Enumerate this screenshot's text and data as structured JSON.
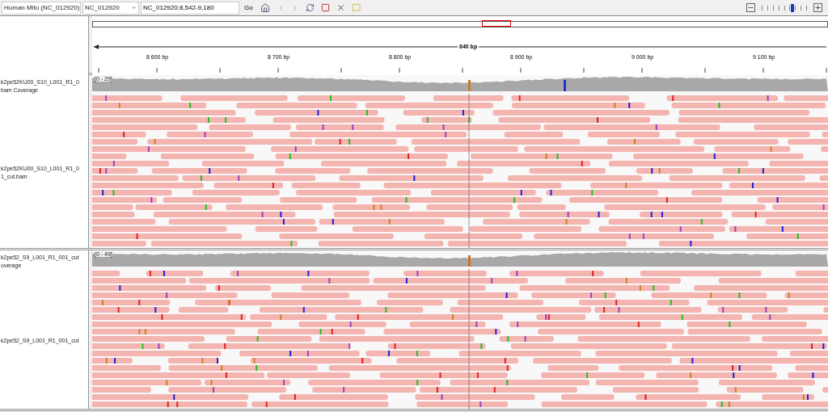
{
  "toolbar": {
    "genome": "Human Mito (NC_012920)",
    "chromosome": "NC_012920",
    "locus": "NC_012920:8,542-9,180",
    "go": "Go"
  },
  "zoom": {
    "level": 0.67
  },
  "ruler": {
    "span": "640 bp",
    "ticks": [
      "8 600 bp",
      "8 700 bp",
      "8 800 bp",
      "8 900 bp",
      "9 000 bp",
      "9 100 bp"
    ]
  },
  "tracks": [
    {
      "coverage_label": [
        "k2pe52KU00_S10_L001_R1_0",
        "bam Coverage"
      ],
      "range": "[0 - 29]",
      "reads_label": [
        "k2pe52KU00_S10_L001_R1_0",
        "1_cut.bam"
      ]
    },
    {
      "coverage_label": [
        "k2pe52_S9_L001_R1_001_cut",
        "overage"
      ],
      "range": "[0 - 49]",
      "reads_label": [
        "k2pe52_S9_L001_R1_001_cut"
      ]
    }
  ]
}
